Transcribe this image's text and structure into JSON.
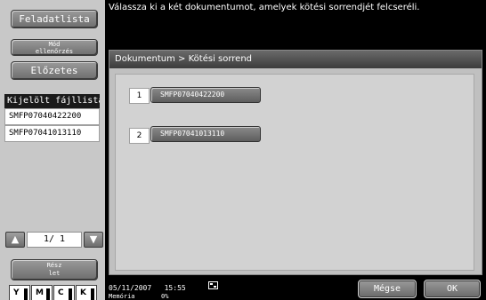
{
  "sidebar": {
    "tasks_label": "Feladatlista",
    "check_label": "Mód\nellenőrzés",
    "preview_label": "Előzetes",
    "file_list_header": "Kijelölt fájllista",
    "files": [
      "SMFP07040422200",
      "SMFP07041013110"
    ],
    "page_indicator": "1/ 1",
    "detail_label": "Rész\nlet",
    "toner": [
      "Y",
      "M",
      "C",
      "K"
    ]
  },
  "header": {
    "message": "Válassza ki a két dokumentumot, amelyek kötési sorrendjét felcseréli."
  },
  "panel": {
    "title": "Dokumentum > Kötési sorrend",
    "items": [
      {
        "number": "1",
        "name": "SMFP07040422200"
      },
      {
        "number": "2",
        "name": "SMFP07041013110"
      }
    ]
  },
  "status": {
    "datetime": "05/11/2007   15:55",
    "memory": "Memória       0%"
  },
  "footer": {
    "cancel_label": "Mégse",
    "ok_label": "OK"
  }
}
